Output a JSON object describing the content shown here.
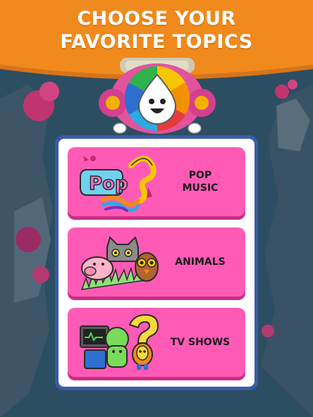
{
  "header": {
    "title_line1": "CHOOSE YOUR",
    "title_line2": "FAVORITE TOPICS"
  },
  "colors": {
    "banner": "#f08a1c",
    "card": "#ff5bb6",
    "panel_border": "#3c5aa8"
  },
  "topics": [
    {
      "label_line1": "POP",
      "label_line2": "MUSIC",
      "icon": "pop-music-icon"
    },
    {
      "label_line1": "ANIMALS",
      "label_line2": "",
      "icon": "animals-icon"
    },
    {
      "label_line1": "TV SHOWS",
      "label_line2": "",
      "icon": "tv-shows-icon"
    }
  ]
}
